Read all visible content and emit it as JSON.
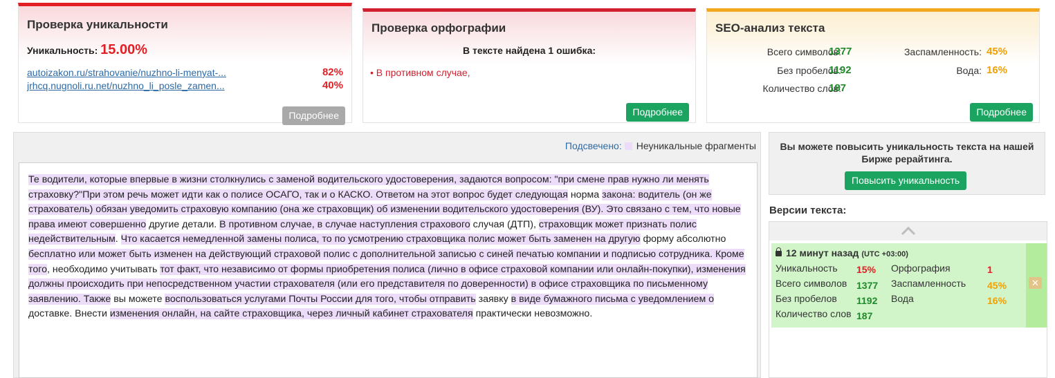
{
  "uniqueness_card": {
    "title": "Проверка уникальности",
    "label": "Уникальность:",
    "value": "15.00%",
    "sources": [
      {
        "url": "autoizakon.ru/strahovanie/nuzhno-li-menyat-...",
        "percent": "82%"
      },
      {
        "url": "jrhcq.nugnoli.ru.net/nuzhno_li_posle_zamen...",
        "percent": "40%"
      }
    ],
    "button": "Подробнее"
  },
  "spelling_card": {
    "title": "Проверка орфографии",
    "message": "В тексте найдена 1 ошибка:",
    "errors": [
      "В противном случае,"
    ],
    "button": "Подробнее"
  },
  "seo_card": {
    "title": "SEO-анализ текста",
    "total_chars_label": "Всего символов:",
    "total_chars": "1377",
    "no_spaces_label": "Без пробелов:",
    "no_spaces": "1192",
    "word_count_label": "Количество слов:",
    "word_count": "187",
    "spam_label": "Заспамленность:",
    "spam": "45%",
    "water_label": "Вода:",
    "water": "16%",
    "button": "Подробнее"
  },
  "text_panel": {
    "legend_label": "Подсвечено:",
    "legend_text": "Неуникальные фрагменты",
    "fragments": [
      {
        "t": "Те водители, которые впервые в жизни столкнулись с заменой водительского удостоверения, задаются вопросом: \"при смене прав нужно ли менять страховку?\"При этом речь может идти как о полисе ОСАГО, так и о КАСКО. Ответом на этот вопрос будет следующая",
        "h": true
      },
      {
        "t": " норма ",
        "h": false
      },
      {
        "t": "закона",
        "h": true
      },
      {
        "t": ": водитель (он же страхователь) обязан уведомить страховую компанию (она же страховщик) об изменении водительского удостоверения (ВУ). Это связано с тем, что новые права имеют совершенно",
        "h": true
      },
      {
        "t": " другие детали. ",
        "h": false
      },
      {
        "t": "В противном случае, в случае наступления страхового",
        "h": true
      },
      {
        "t": " случая (ДТП), ",
        "h": false
      },
      {
        "t": "страховщик может признать полис недействительным",
        "h": true
      },
      {
        "t": ". ",
        "h": false
      },
      {
        "t": "Что касается немедленной замены полиса, то по усмотрению страховщика полис может быть заменен на другую",
        "h": true
      },
      {
        "t": " форму абсолютно ",
        "h": false
      },
      {
        "t": "бесплатно или может быть",
        "h": true
      },
      {
        "t": " изменен на действующий страховой полис с дополнительной записью с синей печатью компании и подписью сотрудника. Кроме того",
        "h": true
      },
      {
        "t": ", необходимо учитывать ",
        "h": false
      },
      {
        "t": "тот факт, что независимо от формы приобретения полиса (лично в офисе страховой компании или онлайн-покупки), изменения должны",
        "h": true
      },
      {
        "t": " происходить при непосредственном участии страхователя (или его представителя по доверенности) в офисе страховщика по письменному заявлению. Также",
        "h": true
      },
      {
        "t": " вы можете ",
        "h": false
      },
      {
        "t": "воспользоваться услугами Почты России для того, чтобы отправить",
        "h": true
      },
      {
        "t": " заявку ",
        "h": false
      },
      {
        "t": "в виде бумажного письма с уведомлением о",
        "h": true
      },
      {
        "t": " доставке. Внести ",
        "h": false
      },
      {
        "t": "изменения онлайн, на сайте страховщика, через личный кабинет страхователя",
        "h": true
      },
      {
        "t": " практически невозможно.",
        "h": false
      }
    ]
  },
  "promo": {
    "text": "Вы можете повысить уникальность текста на нашей Бирже рерайтинга.",
    "button": "Повысить уникальность"
  },
  "versions": {
    "title": "Версии текста:",
    "up_icon": "chevron-up-icon",
    "item": {
      "time": "12 минут назад",
      "tz": "(UTC +03:00)",
      "uniqueness_label": "Уникальность",
      "uniqueness": "15%",
      "spelling_label": "Орфография",
      "spelling": "1",
      "total_chars_label": "Всего символов",
      "total_chars": "1377",
      "spam_label": "Заспамленность",
      "spam": "45%",
      "no_spaces_label": "Без пробелов",
      "no_spaces": "1192",
      "water_label": "Вода",
      "water": "16%",
      "word_count_label": "Количество слов",
      "word_count": "187",
      "close_icon": "close-icon"
    }
  },
  "colors": {
    "red": "#e31e24",
    "green": "#1f8a2a",
    "orange": "#f2a000",
    "button_green": "#1aa460",
    "highlight": "#ecdcfa"
  }
}
